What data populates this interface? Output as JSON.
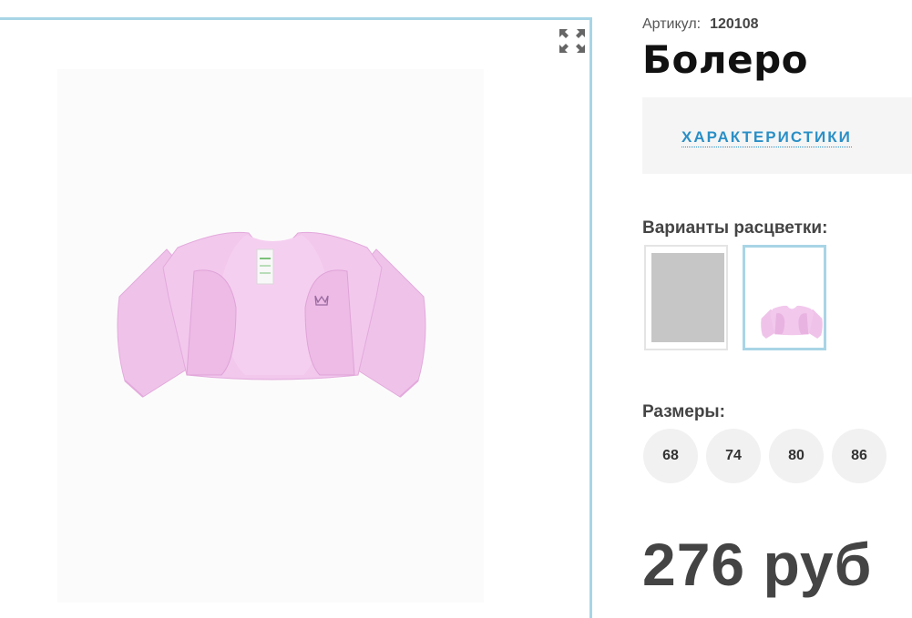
{
  "product": {
    "sku_label": "Артикул:",
    "sku_value": "120108",
    "title": "Болеро",
    "tab_characteristics": "ХАРАКТЕРИСТИКИ",
    "colors_label": "Варианты расцветки:",
    "sizes_label": "Размеры:",
    "sizes": [
      "68",
      "74",
      "80",
      "86"
    ],
    "price": "276 руб"
  },
  "gallery": {
    "expand_icon": "fullscreen-expand-icon",
    "image_subject": "pink-bolero-photo"
  },
  "colors": {
    "accent": "#a8d5e6",
    "link": "#2a8fc6",
    "garment": "#f0c3ea"
  }
}
